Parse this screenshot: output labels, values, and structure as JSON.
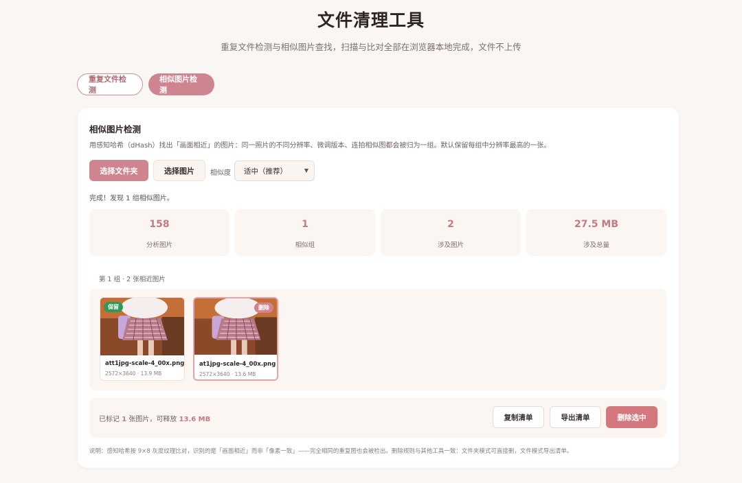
{
  "header": {
    "title": "文件清理工具",
    "subtitle": "重复文件检测与相似图片查找，扫描与比对全部在浏览器本地完成，文件不上传"
  },
  "mode_tabs": [
    {
      "label": "重复文件检测",
      "active": false
    },
    {
      "label": "相似图片检测",
      "active": true
    }
  ],
  "panel": {
    "title": "相似图片检测",
    "description": "用感知哈希（dHash）找出「画面相近」的图片：同一照片的不同分辨率、微调版本、连拍相似图都会被归为一组。默认保留每组中分辨率最高的一张。",
    "choose_folder_label": "选择文件夹",
    "choose_images_label": "选择图片",
    "similarity_label": "相似度",
    "similarity_value": "适中（推荐）",
    "status": "完成！发现 1 组相似图片。"
  },
  "stats": [
    {
      "value": "158",
      "label": "分析图片"
    },
    {
      "value": "1",
      "label": "相似组"
    },
    {
      "value": "2",
      "label": "涉及图片"
    },
    {
      "value": "27.5 MB",
      "label": "涉及总量"
    }
  ],
  "group": {
    "heading": "第 1 组 · 2 张相近图片",
    "items": [
      {
        "badge": "保留",
        "filename": "att1jpg-scale-4_00x.png",
        "meta": "2572×3640 · 13.9 MB",
        "marked": false
      },
      {
        "badge": "删除",
        "filename": "at1jpg-scale-4_00x.png",
        "meta": "2572×3640 · 13.6 MB",
        "marked": true
      }
    ]
  },
  "actions": {
    "summary_prefix": "已标记 ",
    "marked_count": "1",
    "summary_middle": " 张图片，可释放 ",
    "freeable": "13.6 MB",
    "copy_label": "复制清单",
    "export_label": "导出清单",
    "delete_label": "删除选中"
  },
  "footnote": "说明：感知哈希按 9×8 灰度纹理比对，识别的是「画面相近」而非「像素一致」——完全相同的重复图也会被检出。删除规则与其他工具一致：文件夹模式可直接删，文件模式导出清单。",
  "colors": {
    "accent": "#cf858f",
    "accent_text": "#c27a83",
    "keep_badge": "#2e9a5a",
    "delete_button": "#d4787f",
    "background": "#faf6f3"
  }
}
